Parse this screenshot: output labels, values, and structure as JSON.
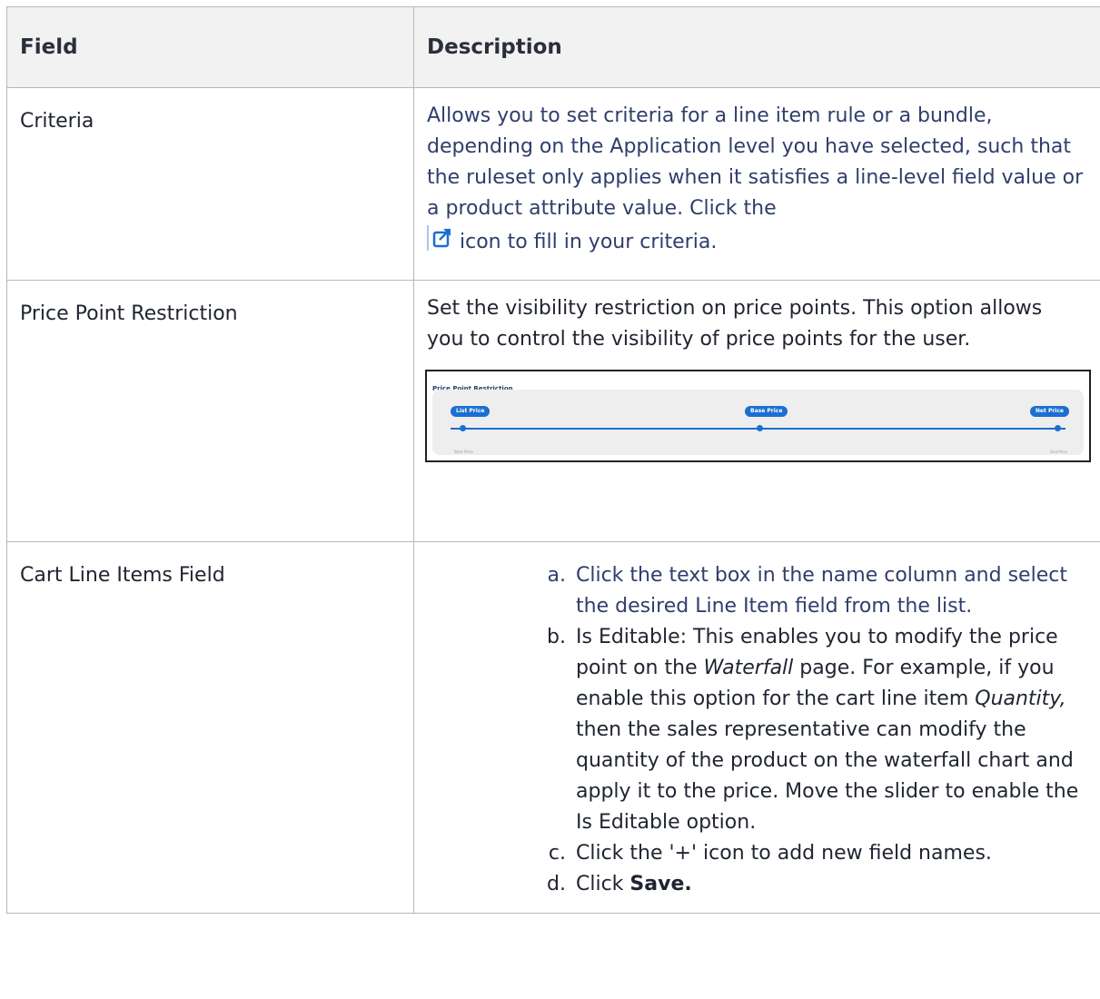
{
  "table": {
    "header": {
      "field": "Field",
      "description": "Description"
    },
    "rows": {
      "criteria": {
        "field": "Criteria",
        "desc_a": "Allows you to set criteria for a line item rule or a bundle, depending on the Application level you have selected, such that the ruleset only applies when it satisfies a line-level field value or a product attribute value. Click the ",
        "desc_b": "icon to fill in your criteria.",
        "icon": "external-link-icon"
      },
      "price_point": {
        "field": "Price Point Restriction",
        "desc": "Set the visibility restriction on price points. This option allows you to control the visibility of price points for the user.",
        "image": {
          "title": "Price Point Restriction",
          "pills": [
            "List Price",
            "Base Price",
            "Net Price"
          ],
          "start_label": "Start Price",
          "end_label": "End Price"
        }
      },
      "cart": {
        "field": "Cart Line Items Field",
        "steps": {
          "a": "Click the text box in the name column and select the desired Line Item field from the list.",
          "b1": "Is Editable: This enables you to modify the price point on the ",
          "b_em1": "Waterfall",
          "b2": " page. For example, if you enable this option for the cart line item ",
          "b_em2": "Quantity,",
          "b3": " then the sales representative can modify the quantity of the product on the waterfall chart and apply it to the price. Move the slider to enable the Is Editable option.",
          "c": "Click the '+' icon to add new field names.",
          "d1": "Click ",
          "d_bold": "Save."
        }
      }
    }
  },
  "colors": {
    "accent": "#1a6fd1",
    "navy_text": "#2f3e6b",
    "header_bg": "#f2f2f2",
    "border": "#b8b8b8"
  }
}
